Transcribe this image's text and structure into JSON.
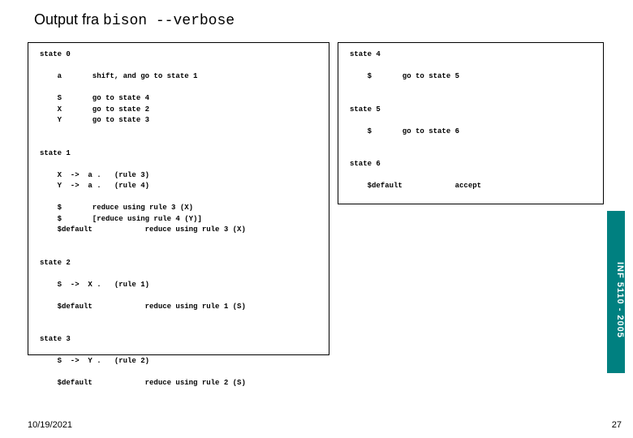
{
  "title_prefix": "Output fra ",
  "title_cmd": "bison --verbose",
  "left_box": "state 0\n\n    a       shift, and go to state 1\n\n    S       go to state 4\n    X       go to state 2\n    Y       go to state 3\n\n\nstate 1\n\n    X  ->  a .   (rule 3)\n    Y  ->  a .   (rule 4)\n\n    $       reduce using rule 3 (X)\n    $       [reduce using rule 4 (Y)]\n    $default            reduce using rule 3 (X)\n\n\nstate 2\n\n    S  ->  X .   (rule 1)\n\n    $default            reduce using rule 1 (S)\n\n\nstate 3\n\n    S  ->  Y .   (rule 2)\n\n    $default            reduce using rule 2 (S)",
  "right_box": "state 4\n\n    $       go to state 5\n\n\nstate 5\n\n    $       go to state 6\n\n\nstate 6\n\n    $default            accept",
  "sidebar_text": "INF 5110 - 2005",
  "footer_date": "10/19/2021",
  "page_num": "27"
}
